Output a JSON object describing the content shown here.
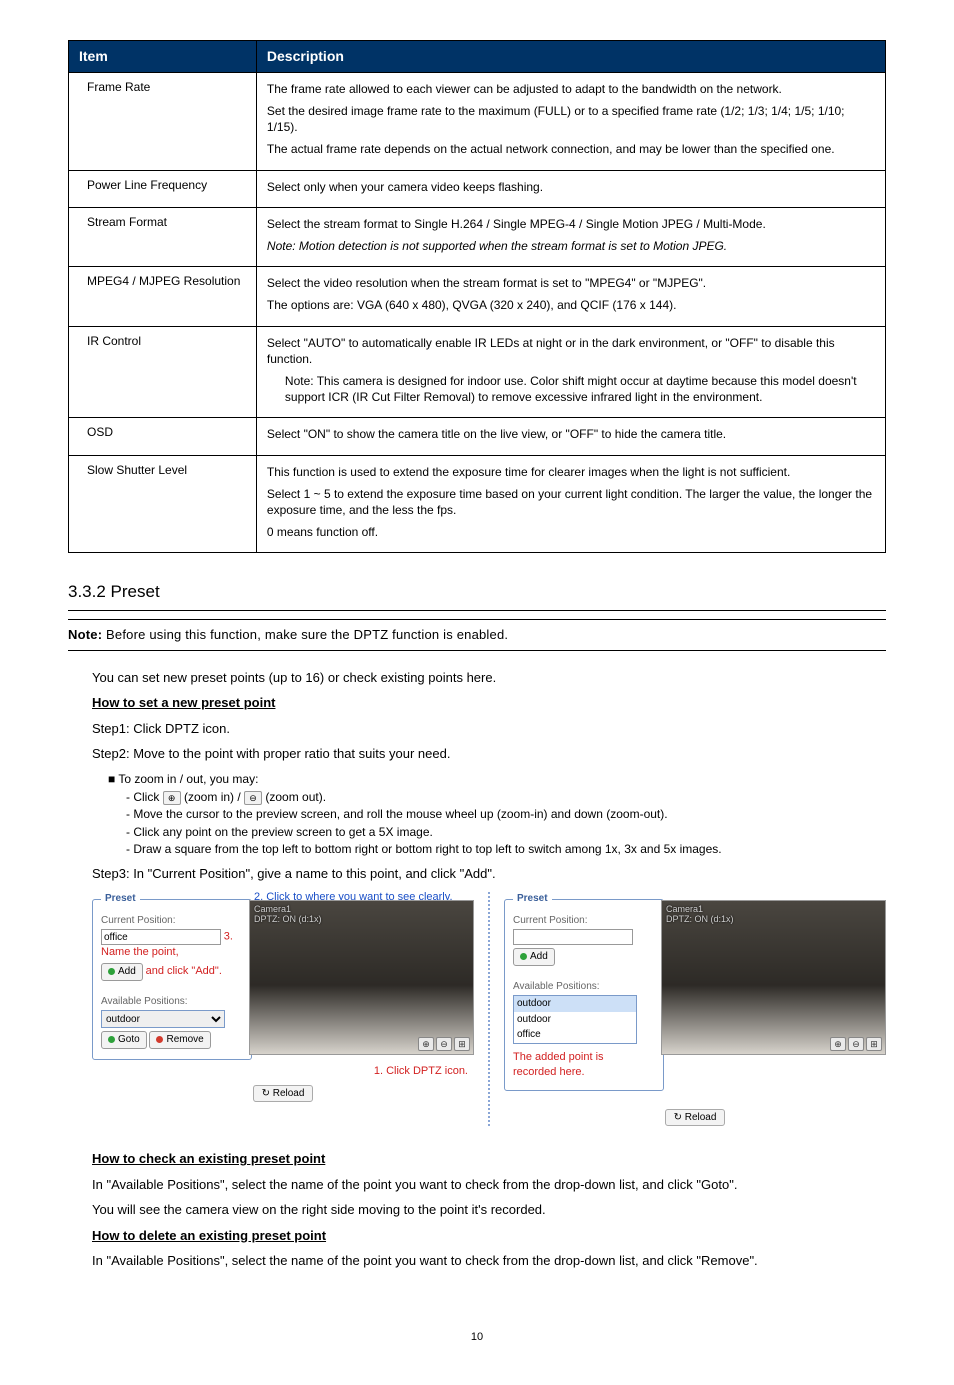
{
  "table": {
    "header": {
      "item": "Item",
      "desc": "Description"
    },
    "rows": [
      {
        "item": "Frame Rate",
        "desc": [
          {
            "t": "The frame rate allowed to each viewer can be adjusted to adapt to the bandwidth on the network."
          },
          {
            "t": "Set the desired image frame rate to the maximum (FULL) or to a specified frame rate (1/2; 1/3; 1/4; 1/5; 1/10; 1/15)."
          },
          {
            "t": "The actual frame rate depends on the actual network connection, and may be lower than the specified one."
          }
        ]
      },
      {
        "item": "Power Line Frequency",
        "desc": [
          {
            "t": "Select only when your camera video keeps flashing."
          }
        ]
      },
      {
        "item": "Stream Format",
        "desc": [
          {
            "t": "Select the stream format to Single H.264 / Single MPEG-4 / Single Motion JPEG / Multi-Mode."
          },
          {
            "t": "Note: Motion detection is not supported when the stream format is set to Motion JPEG.",
            "note": true
          }
        ]
      },
      {
        "item": "MPEG4 / MJPEG Resolution",
        "desc": [
          {
            "t": "Select the video resolution when the stream format is set to \"MPEG4\" or \"MJPEG\"."
          },
          {
            "t": "The options are: VGA (640 x 480), QVGA (320 x 240), and QCIF (176 x 144)."
          }
        ]
      },
      {
        "item": "IR Control",
        "desc": [
          {
            "t": "Select \"AUTO\" to automatically enable IR LEDs at night or in the dark environment, or \"OFF\" to disable this function."
          },
          {
            "t": "Note: This camera is designed for indoor use. Color shift might occur at daytime because this model doesn't support ICR (IR Cut Filter Removal) to remove excessive infrared light in the environment.",
            "indent": true
          }
        ]
      },
      {
        "item": "OSD",
        "desc": [
          {
            "t": "Select \"ON\" to show the camera title on the live view, or \"OFF\" to hide the camera title."
          }
        ]
      },
      {
        "item": "Slow Shutter Level",
        "desc": [
          {
            "t": "This function is used to extend the exposure time for clearer images when the light is not sufficient."
          },
          {
            "t": "Select 1 ~ 5 to extend the exposure time based on your current light condition. The larger the value, the longer the exposure time, and the less the fps."
          },
          {
            "t": "0 means function off."
          }
        ]
      }
    ]
  },
  "section_title": "3.3.2 Preset",
  "note_prefix": "Note:",
  "note_text": "Before using this function, make sure the DPTZ function is enabled.",
  "intro": "You can set new preset points (up to 16) or check existing points here.",
  "howto_new": "How to set a new preset point",
  "step1": "Step1: Click DPTZ icon.",
  "step2": "Step2: Move to the point with proper ratio that suits your need.",
  "zoom_lead": "To zoom in / out, you may:",
  "zoom_items": {
    "a_pre": "- Click ",
    "a_mid": " (zoom in) / ",
    "a_post": " (zoom out).",
    "b": "- Move the cursor to the preview screen, and roll the mouse wheel up (zoom-in) and down (zoom-out).",
    "c": "- Click any point on the preview screen to get a 5X image.",
    "d": "- Draw a square from the top left to bottom right or bottom right to top left to switch among 1x, 3x and 5x images."
  },
  "step3": "Step3: In \"Current Position\", give a name to this point, and click \"Add\".",
  "panelA": {
    "legend": "Preset",
    "cur_label": "Current Position:",
    "cur_value": "office",
    "ann_name": "3. Name the point,",
    "ann_add": "and click \"Add\".",
    "add_btn": "Add",
    "avail_label": "Available Positions:",
    "avail_value": "outdoor",
    "goto_btn": "Goto",
    "remove_btn": "Remove",
    "header_ann": "2. Click to where you want to see clearly.",
    "cam_label1": "Camera1",
    "cam_label2": "DPTZ: ON (d:1x)",
    "bottom_ann": "1. Click DPTZ icon.",
    "reload": "Reload"
  },
  "panelB": {
    "legend": "Preset",
    "cur_label": "Current Position:",
    "cur_value": "",
    "add_btn": "Add",
    "avail_label": "Available Positions:",
    "avail_selected": "outdoor",
    "opt1": "outdoor",
    "opt2": "office",
    "ann1": "The added point is",
    "ann2": "recorded here.",
    "cam_label1": "Camera1",
    "cam_label2": "DPTZ: ON (d:1x)",
    "reload": "Reload"
  },
  "howto_check": "How to check an existing preset point",
  "check_p1": "In \"Available Positions\", select the name of the point you want to check from the drop-down list, and click \"Goto\".",
  "check_p2": "You will see the camera view on the right side moving to the point it's recorded.",
  "howto_delete": "How to delete an existing preset point",
  "delete_p": "In \"Available Positions\", select the name of the point you want to check from the drop-down list, and click \"Remove\".",
  "page": "10",
  "glyph": {
    "plus": "⊕",
    "minus": "⊖",
    "grid": "⊞",
    "refresh": "↻"
  }
}
